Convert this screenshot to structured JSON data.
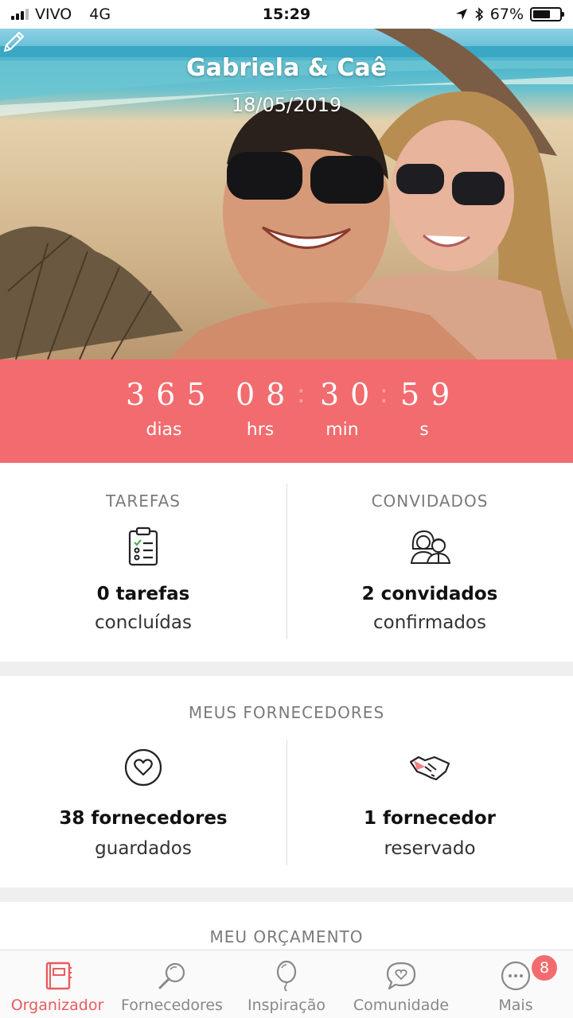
{
  "status_bar": {
    "carrier": "VIVO",
    "network": "4G",
    "time": "15:29",
    "battery": "67%",
    "battery_level": 0.67
  },
  "hero": {
    "title": "Gabriela & Caê",
    "date": "18/05/2019"
  },
  "countdown": {
    "days": "365",
    "hours": "08",
    "minutes": "30",
    "seconds": "59",
    "days_label": "dias",
    "hours_label": "hrs",
    "minutes_label": "min",
    "seconds_label": "s",
    "bg_color": "#f26b6e"
  },
  "tasks": {
    "title": "TAREFAS",
    "count": "0 tarefas",
    "status": "concluídas"
  },
  "guests": {
    "title": "CONVIDADOS",
    "count": "2 convidados",
    "status": "confirmados"
  },
  "vendors": {
    "title": "MEUS FORNECEDORES",
    "saved_count": "38 fornecedores",
    "saved_label": "guardados",
    "booked_count": "1 fornecedor",
    "booked_label": "reservado"
  },
  "budget": {
    "title": "MEU ORÇAMENTO"
  },
  "tabbar": {
    "items": [
      {
        "label": "Organizador",
        "icon": "planner-icon",
        "active": true
      },
      {
        "label": "Fornecedores",
        "icon": "search-icon"
      },
      {
        "label": "Inspiração",
        "icon": "balloon-icon"
      },
      {
        "label": "Comunidade",
        "icon": "chat-heart-icon"
      },
      {
        "label": "Mais",
        "icon": "more-icon",
        "badge": "8"
      }
    ],
    "accent": "#e85b5f"
  }
}
